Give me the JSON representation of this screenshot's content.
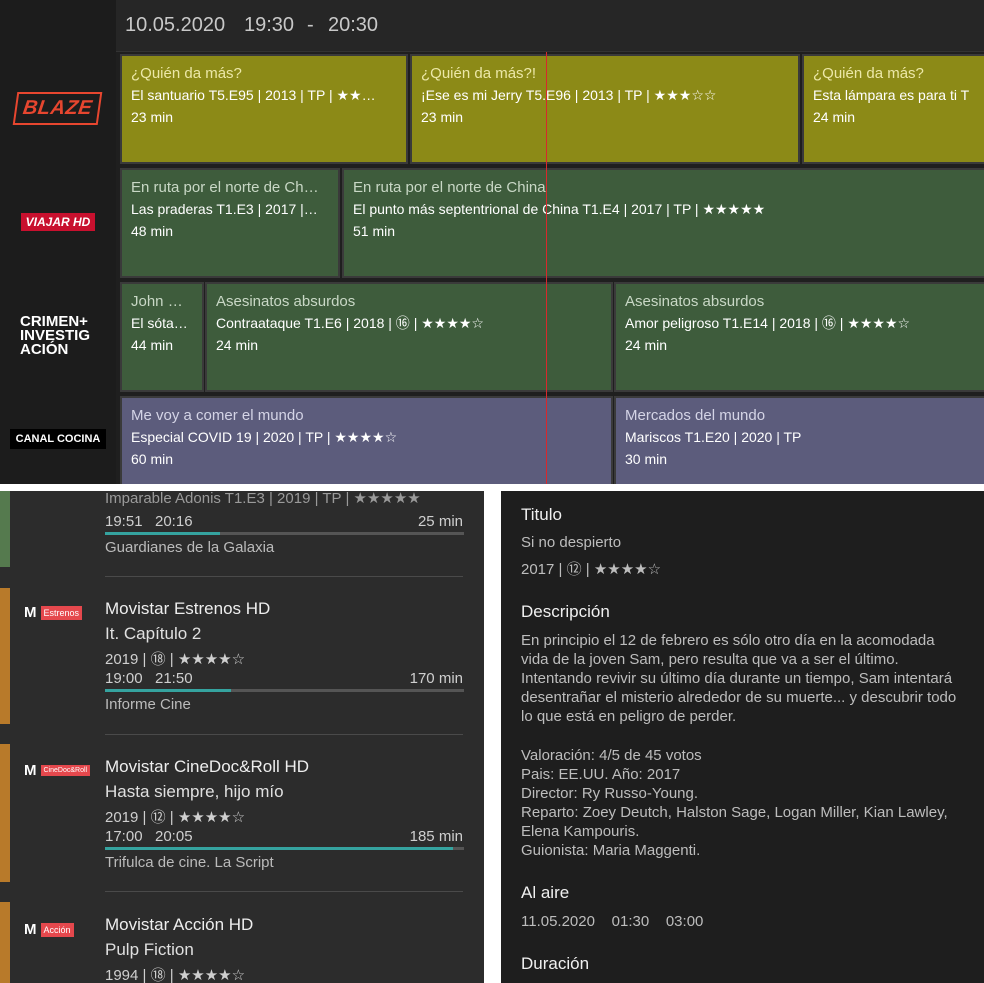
{
  "epg": {
    "date": "10.05.2020",
    "start": "19:30",
    "sep": "-",
    "end": "20:30",
    "channels": [
      {
        "name": "BLAZE",
        "logo_color": "#e7462f"
      },
      {
        "name": "VIAJAR HD",
        "logo_color": "#c8102e"
      },
      {
        "name": "CRIMEN+ INVESTIGACIÓN",
        "logo_color": "#ffffff"
      },
      {
        "name": "CANAL COCINA",
        "logo_color": "#ffffff"
      }
    ],
    "rows": [
      [
        {
          "title": "¿Quién da más?",
          "sub": "El santuario T5.E95 | 2013 | TP | ★★…",
          "dur": "23 min"
        },
        {
          "title": "¿Quién da más?!",
          "sub": "¡Ese es mi Jerry T5.E96 | 2013 | TP | ★★★☆☆",
          "dur": "23 min"
        },
        {
          "title": "¿Quién da más?",
          "sub": "Esta lámpara es para ti T",
          "dur": "24 min"
        }
      ],
      [
        {
          "title": "En ruta por el norte de Ch…",
          "sub": "Las praderas T1.E3 | 2017 |…",
          "dur": "48 min"
        },
        {
          "title": "En ruta por el norte de China",
          "sub": "El punto más septentrional de China T1.E4 | 2017 | TP | ★★★★★",
          "dur": "51 min"
        }
      ],
      [
        {
          "title": "John …",
          "sub": "El sóta…",
          "dur": "44 min"
        },
        {
          "title": "Asesinatos absurdos",
          "sub": "Contraataque T1.E6 | 2018 | ⑯ | ★★★★☆",
          "dur": "24 min"
        },
        {
          "title": "Asesinatos absurdos",
          "sub": "Amor peligroso T1.E14 | 2018 | ⑯ | ★★★★☆",
          "dur": "24 min"
        }
      ],
      [
        {
          "title": "Me voy a comer el mundo",
          "sub": "Especial COVID 19 | 2020 | TP | ★★★★☆",
          "dur": "60 min"
        },
        {
          "title": "Mercados del mundo",
          "sub": "Mariscos T1.E20 | 2020 | TP",
          "dur": "30 min"
        }
      ]
    ]
  },
  "list": {
    "top_partial": {
      "sub": "Imparable Adonis T1.E3 | 2019 | TP | ★★★★★",
      "start": "19:51",
      "end": "20:16",
      "dur": "25 min",
      "progress": 0.32,
      "next": "Guardianes de la Galaxia"
    },
    "items": [
      {
        "channel": "Movistar Estrenos HD",
        "tag": "Estrenos",
        "program": "It. Capítulo 2",
        "meta": "2019 | ⑱ | ★★★★☆",
        "start": "19:00",
        "end": "21:50",
        "dur": "170 min",
        "progress": 0.35,
        "next": "Informe Cine",
        "accent": "#b87a2a"
      },
      {
        "channel": "Movistar CineDoc&Roll HD",
        "tag": "CineDoc&Roll",
        "program": "Hasta siempre, hijo mío",
        "meta": "2019 | ⑫ | ★★★★☆",
        "start": "17:00",
        "end": "20:05",
        "dur": "185 min",
        "progress": 0.97,
        "next": "Trifulca de cine. La Script",
        "accent": "#b87a2a"
      },
      {
        "channel": "Movistar Acción HD",
        "tag": "Acción",
        "program": "Pulp Fiction",
        "meta": "1994 | ⑱ | ★★★★☆",
        "accent": "#b87a2a"
      }
    ]
  },
  "detail": {
    "titulo_h": "Titulo",
    "titulo": "Si no despierto",
    "titulo_meta": "2017 | ⑫ | ★★★★☆",
    "desc_h": "Descripción",
    "desc": "En principio el 12 de febrero es sólo otro día en la acomodada vida de la joven Sam, pero resulta que va a ser el último. Intentando revivir su último día durante un tiempo, Sam intentará desentrañar el misterio alrededor de su muerte... y descubrir todo lo que está en peligro de perder.",
    "valoracion": "Valoración: 4/5 de 45 votos",
    "pais": "Pais: EE.UU.  Año: 2017",
    "director": "Director: Ry Russo-Young.",
    "reparto": "Reparto: Zoey Deutch, Halston Sage, Logan Miller, Kian Lawley, Elena Kampouris.",
    "guionista": "Guionista: Maria Maggenti.",
    "aire_h": "Al aire",
    "aire": "11.05.2020    01:30    03:00",
    "duracion_h": "Duración"
  },
  "colors": {
    "now_line": "#d8282c",
    "progress": "#35a39f",
    "tag": "#e5484d"
  }
}
